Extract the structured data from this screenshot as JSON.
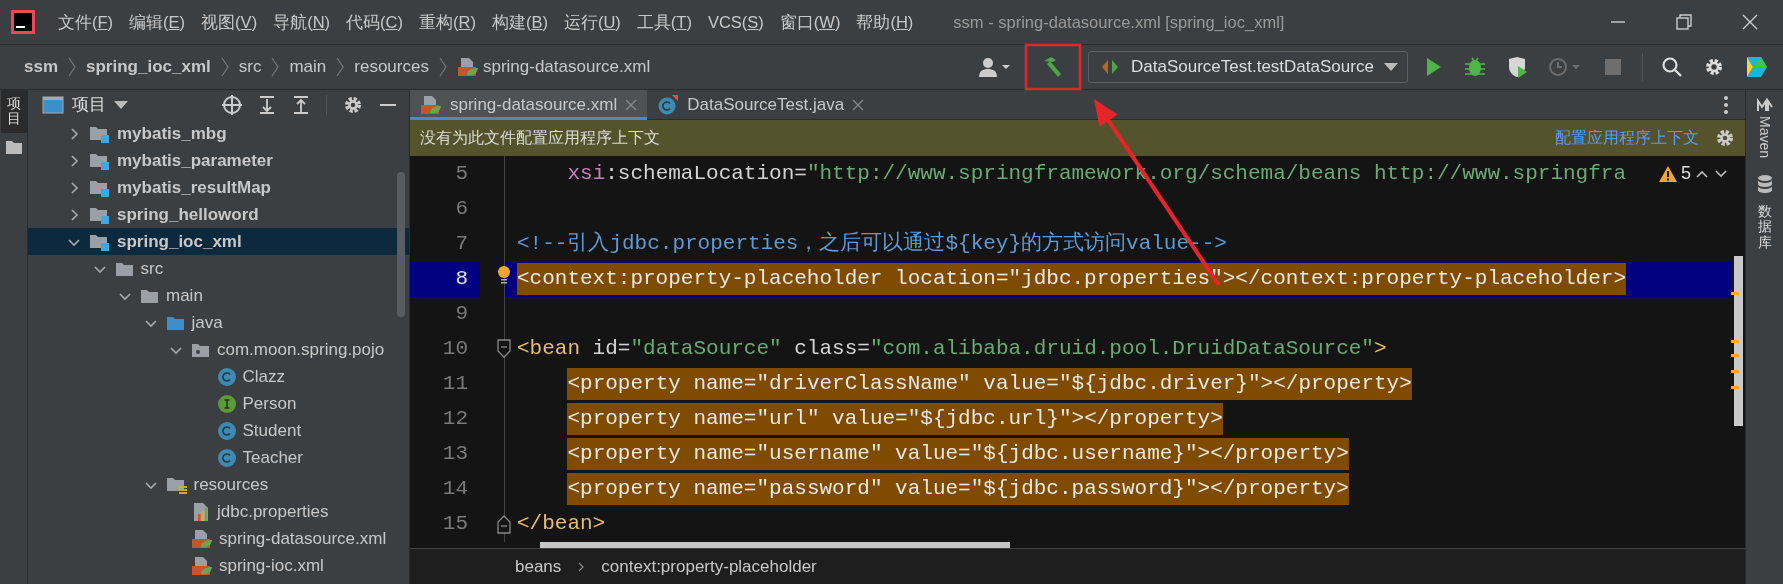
{
  "window": {
    "title": "ssm - spring-datasource.xml [spring_ioc_xml]"
  },
  "menu": [
    {
      "label": "文件(F)"
    },
    {
      "label": "编辑(E)"
    },
    {
      "label": "视图(V)"
    },
    {
      "label": "导航(N)"
    },
    {
      "label": "代码(C)"
    },
    {
      "label": "重构(R)"
    },
    {
      "label": "构建(B)"
    },
    {
      "label": "运行(U)"
    },
    {
      "label": "工具(T)"
    },
    {
      "label": "VCS(S)"
    },
    {
      "label": "窗口(W)"
    },
    {
      "label": "帮助(H)"
    }
  ],
  "breadcrumb": [
    {
      "label": "ssm",
      "kind": "project"
    },
    {
      "label": "spring_ioc_xml",
      "kind": "module"
    },
    {
      "label": "src",
      "kind": "folder"
    },
    {
      "label": "main",
      "kind": "folder"
    },
    {
      "label": "resources",
      "kind": "folder"
    },
    {
      "label": "spring-datasource.xml",
      "kind": "xml"
    }
  ],
  "run_config": {
    "label": "DataSourceTest.testDataSource"
  },
  "run_buttons": [
    {
      "kind": "run",
      "disabled": false
    },
    {
      "kind": "debug",
      "disabled": false
    },
    {
      "kind": "coverage",
      "disabled": false
    },
    {
      "kind": "profile",
      "disabled": true
    },
    {
      "kind": "stop",
      "disabled": true
    }
  ],
  "left_stripe": {
    "label": "项目",
    "selected": true
  },
  "project_panel": {
    "title": "项目"
  },
  "project_tree": [
    {
      "label": "mybatis_mbg",
      "kind": "module",
      "expanded": false,
      "selected": false
    },
    {
      "label": "mybatis_parameter",
      "kind": "module",
      "expanded": false,
      "selected": false
    },
    {
      "label": "mybatis_resultMap",
      "kind": "module",
      "expanded": false,
      "selected": false
    },
    {
      "label": "spring_helloword",
      "kind": "module",
      "expanded": false,
      "selected": false
    },
    {
      "label": "spring_ioc_xml",
      "kind": "module",
      "expanded": true,
      "selected": true,
      "children": [
        {
          "label": "src",
          "kind": "folder",
          "expanded": true,
          "selected": false,
          "children": [
            {
              "label": "main",
              "kind": "folder",
              "expanded": true,
              "selected": false,
              "children": [
                {
                  "label": "java",
                  "kind": "source",
                  "expanded": true,
                  "selected": false,
                  "children": [
                    {
                      "label": "com.moon.spring.pojo",
                      "kind": "package",
                      "expanded": true,
                      "selected": false,
                      "children": [
                        {
                          "label": "Clazz",
                          "kind": "class",
                          "selected": false
                        },
                        {
                          "label": "Person",
                          "kind": "interface",
                          "selected": false
                        },
                        {
                          "label": "Student",
                          "kind": "class",
                          "selected": false
                        },
                        {
                          "label": "Teacher",
                          "kind": "class",
                          "selected": false
                        }
                      ]
                    }
                  ]
                },
                {
                  "label": "resources",
                  "kind": "resources",
                  "expanded": true,
                  "selected": false,
                  "children": [
                    {
                      "label": "jdbc.properties",
                      "kind": "properties",
                      "selected": false
                    },
                    {
                      "label": "spring-datasource.xml",
                      "kind": "xml",
                      "selected": false
                    },
                    {
                      "label": "spring-ioc.xml",
                      "kind": "xml",
                      "selected": false
                    }
                  ]
                }
              ]
            }
          ]
        }
      ]
    }
  ],
  "editor_tabs": [
    {
      "label": "spring-datasource.xml",
      "kind": "xml",
      "selected": true
    },
    {
      "label": "DataSourceTest.java",
      "kind": "java",
      "selected": false
    }
  ],
  "notification": {
    "message": "没有为此文件配置应用程序上下文",
    "action": "配置应用程序上下文"
  },
  "inspections": {
    "count": "5"
  },
  "code_lines": [
    {
      "number": "5",
      "tokens": [
        {
          "kind": "ns",
          "text": "    xsi"
        },
        {
          "kind": "attr",
          "text": ":schemaLocation="
        },
        {
          "kind": "value",
          "text": "\"http://www.springframework.org/schema/beans http://www.springfra"
        }
      ]
    },
    {
      "number": "6"
    },
    {
      "number": "7",
      "tokens": [
        {
          "kind": "comment",
          "text": "<!--引入jdbc.properties，之后可以通过${key}的方式访问value-->"
        }
      ]
    },
    {
      "number": "8",
      "current": true,
      "highlighted": true,
      "intention": true,
      "tokens": [
        {
          "kind": "tag",
          "text": "<context:property-placeholder"
        },
        {
          "kind": "attr",
          "text": " location="
        },
        {
          "kind": "value",
          "text": "\"jdbc.properties\""
        },
        {
          "kind": "tag",
          "text": "></context:property-placeholder>"
        }
      ]
    },
    {
      "number": "9"
    },
    {
      "number": "10",
      "fold_start": true,
      "tokens": [
        {
          "kind": "tag",
          "text": "<bean"
        },
        {
          "kind": "attr",
          "text": " id="
        },
        {
          "kind": "value",
          "text": "\"dataSource\""
        },
        {
          "kind": "attr",
          "text": " class="
        },
        {
          "kind": "value",
          "text": "\"com.alibaba.druid.pool.DruidDataSource\""
        },
        {
          "kind": "tag",
          "text": ">"
        }
      ]
    },
    {
      "number": "11",
      "highlighted": true,
      "tokens": [
        {
          "kind": "tag",
          "text": "    <property"
        },
        {
          "kind": "attr",
          "text": " name="
        },
        {
          "kind": "value",
          "text": "\"driverClassName\""
        },
        {
          "kind": "attr",
          "text": " value="
        },
        {
          "kind": "value",
          "text": "\"${jdbc.driver}\""
        },
        {
          "kind": "tag",
          "text": "></property>"
        }
      ]
    },
    {
      "number": "12",
      "highlighted": true,
      "tokens": [
        {
          "kind": "tag",
          "text": "    <property"
        },
        {
          "kind": "attr",
          "text": " name="
        },
        {
          "kind": "value",
          "text": "\"url\""
        },
        {
          "kind": "attr",
          "text": " value="
        },
        {
          "kind": "value",
          "text": "\"${jdbc.url}\""
        },
        {
          "kind": "tag",
          "text": "></property>"
        }
      ]
    },
    {
      "number": "13",
      "highlighted": true,
      "tokens": [
        {
          "kind": "tag",
          "text": "    <property"
        },
        {
          "kind": "attr",
          "text": " name="
        },
        {
          "kind": "value",
          "text": "\"username\""
        },
        {
          "kind": "attr",
          "text": " value="
        },
        {
          "kind": "value",
          "text": "\"${jdbc.username}\""
        },
        {
          "kind": "tag",
          "text": "></property>"
        }
      ]
    },
    {
      "number": "14",
      "highlighted": true,
      "tokens": [
        {
          "kind": "tag",
          "text": "    <property"
        },
        {
          "kind": "attr",
          "text": " name="
        },
        {
          "kind": "value",
          "text": "\"password\""
        },
        {
          "kind": "attr",
          "text": " value="
        },
        {
          "kind": "value",
          "text": "\"${jdbc.password}\""
        },
        {
          "kind": "tag",
          "text": "></property>"
        }
      ]
    },
    {
      "number": "15",
      "fold_end": true,
      "tokens": [
        {
          "kind": "tag",
          "text": "</bean>"
        }
      ]
    }
  ],
  "editor_breadcrumb": [
    {
      "label": "beans"
    },
    {
      "label": "context:property-placeholder"
    }
  ],
  "right_stripe": [
    {
      "label": "Maven",
      "kind": "maven"
    },
    {
      "label": "数据库",
      "kind": "database"
    }
  ]
}
